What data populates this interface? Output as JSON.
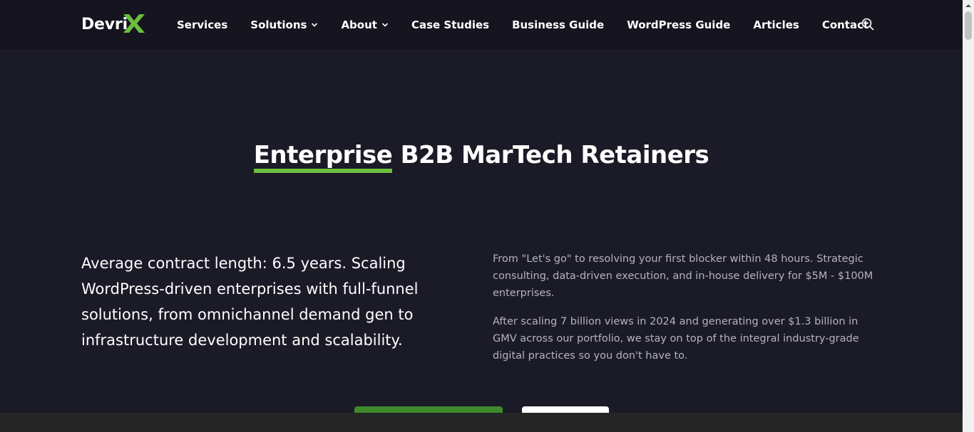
{
  "brand": {
    "logo_text": "Devri",
    "accent": "#6cbf3c",
    "background": "#1b1a27"
  },
  "nav": {
    "items": [
      {
        "label": "Services",
        "has_dropdown": false
      },
      {
        "label": "Solutions",
        "has_dropdown": true
      },
      {
        "label": "About",
        "has_dropdown": true
      },
      {
        "label": "Case Studies",
        "has_dropdown": false
      },
      {
        "label": "Business Guide",
        "has_dropdown": false
      },
      {
        "label": "WordPress Guide",
        "has_dropdown": false
      },
      {
        "label": "Articles",
        "has_dropdown": false
      },
      {
        "label": "Contact",
        "has_dropdown": false
      }
    ]
  },
  "hero": {
    "title_highlight": "Enterprise",
    "title_rest": "B2B MarTech Retainers",
    "lead": "Average contract length: 6.5 years. Scaling WordPress-driven enterprises with full-funnel solutions, from omnichannel demand gen to infrastructure development and scalability.",
    "paragraph_1": "From \"Let's go\" to resolving your first blocker within 48 hours. Strategic consulting, data-driven execution, and in-house delivery for $5M - $100M enterprises.",
    "paragraph_2": "After scaling 7 billion views in 2024 and generating over $1.3 billion in GMV across our portfolio, we stay on top of the integral industry-grade digital practices so you don't have to."
  }
}
